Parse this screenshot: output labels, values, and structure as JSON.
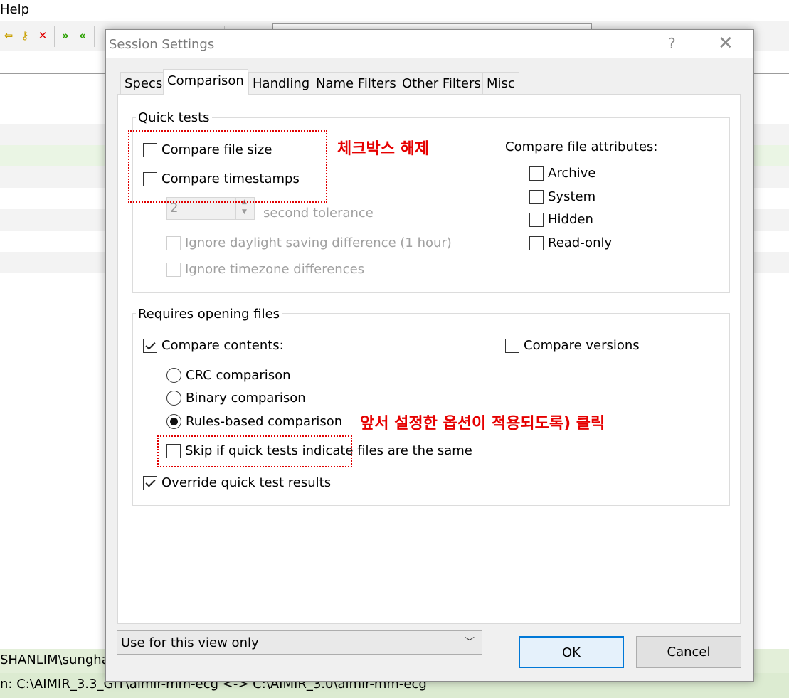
{
  "background": {
    "menu_help": "Help",
    "status_line1": "SHANLIM\\sungha",
    "status_line2": "n: C:\\AIMIR_3.3_GIT\\aimir-mm-ecg <-> C:\\AIMIR_3.0\\aimir-mm-ecg"
  },
  "dialog": {
    "title": "Session Settings",
    "help_glyph": "?",
    "close_glyph": "✕"
  },
  "tabs": [
    {
      "label": "Specs"
    },
    {
      "label": "Comparison"
    },
    {
      "label": "Handling"
    },
    {
      "label": "Name Filters"
    },
    {
      "label": "Other Filters"
    },
    {
      "label": "Misc"
    }
  ],
  "quick_tests": {
    "title": "Quick tests",
    "compare_file_size": {
      "label": "Compare file size",
      "checked": false
    },
    "compare_timestamps": {
      "label": "Compare timestamps",
      "checked": false
    },
    "tolerance_value": "2",
    "tolerance_label": "second tolerance",
    "ignore_dst": {
      "label": "Ignore daylight saving difference (1 hour)",
      "checked": false,
      "disabled": true
    },
    "ignore_tz": {
      "label": "Ignore timezone differences",
      "checked": false,
      "disabled": true
    },
    "attributes_title": "Compare file attributes:",
    "attributes": [
      {
        "label": "Archive",
        "checked": false
      },
      {
        "label": "System",
        "checked": false
      },
      {
        "label": "Hidden",
        "checked": false
      },
      {
        "label": "Read-only",
        "checked": false
      }
    ]
  },
  "requires_opening": {
    "title": "Requires opening files",
    "compare_contents": {
      "label": "Compare contents:",
      "checked": true
    },
    "compare_versions": {
      "label": "Compare versions",
      "checked": false
    },
    "crc": {
      "label": "CRC comparison",
      "selected": false
    },
    "binary": {
      "label": "Binary comparison",
      "selected": false
    },
    "rules": {
      "label": "Rules-based comparison",
      "selected": true
    },
    "skip_if_same": {
      "label": "Skip if quick tests indicate files are the same",
      "checked": false
    },
    "override_quick": {
      "label": "Override quick test results",
      "checked": true
    }
  },
  "annotations": {
    "uncheck_note": "체크박스 해제",
    "click_note": "앞서 설정한 옵션이 적용되도록) 클릭"
  },
  "footer": {
    "scope_value": "Use for this view only",
    "ok_label": "OK",
    "cancel_label": "Cancel"
  },
  "colors": {
    "annotation_red": "#e60000",
    "ok_border": "#0078d7",
    "status_green": "#e3efd9"
  }
}
